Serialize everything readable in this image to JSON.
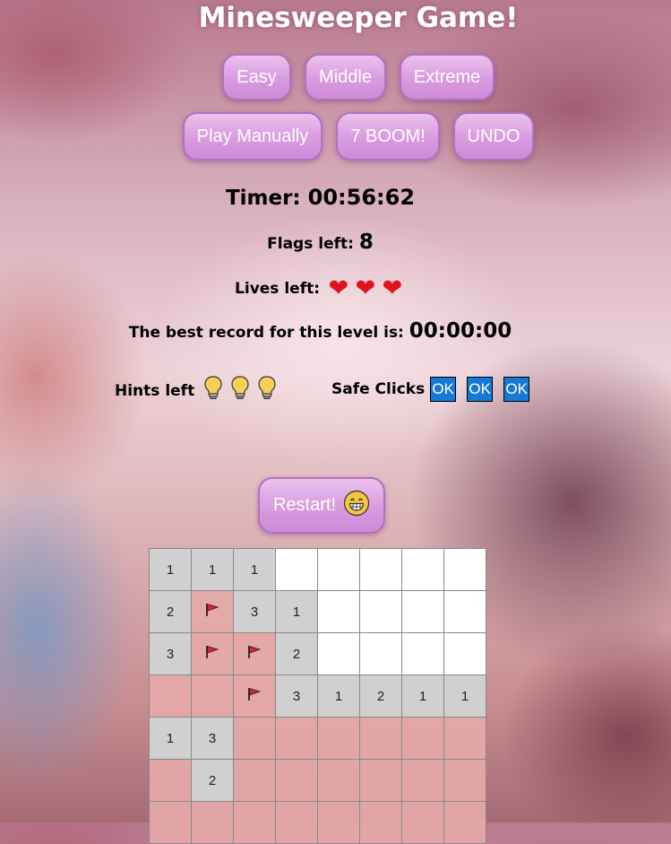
{
  "title": "Minesweeper Game!",
  "levels": [
    "Easy",
    "Middle",
    "Extreme"
  ],
  "actions": [
    "Play Manually",
    "7 BOOM!",
    "UNDO"
  ],
  "timer": {
    "label": "Timer:",
    "value": "00:56:62"
  },
  "flags": {
    "label": "Flags left:",
    "value": "8"
  },
  "lives": {
    "label": "Lives left:",
    "count": 3,
    "icon": "heart-icon",
    "color": "#e0141e"
  },
  "record": {
    "label": "The best record for this level is:",
    "value": "00:00:00"
  },
  "hints": {
    "label": "Hints left",
    "count": 3,
    "icon": "lightbulb-icon"
  },
  "safe_clicks": {
    "label": "Safe Clicks",
    "buttons": [
      "OK",
      "OK",
      "OK"
    ]
  },
  "restart": {
    "label": "Restart!",
    "icon": "grinning-face-icon"
  },
  "colors": {
    "hidden": "#e5a9a9",
    "open": "#d0d0d0",
    "empty": "#ffffff",
    "ok_button": "#1779d6",
    "button": "#d99be0"
  },
  "board": [
    [
      {
        "s": "open",
        "v": "1"
      },
      {
        "s": "open",
        "v": "1"
      },
      {
        "s": "open",
        "v": "1"
      },
      {
        "s": "empty",
        "v": ""
      },
      {
        "s": "empty",
        "v": ""
      },
      {
        "s": "empty",
        "v": ""
      },
      {
        "s": "empty",
        "v": ""
      },
      {
        "s": "empty",
        "v": ""
      }
    ],
    [
      {
        "s": "open",
        "v": "2"
      },
      {
        "s": "flag",
        "v": ""
      },
      {
        "s": "open",
        "v": "3"
      },
      {
        "s": "open",
        "v": "1"
      },
      {
        "s": "empty",
        "v": ""
      },
      {
        "s": "empty",
        "v": ""
      },
      {
        "s": "empty",
        "v": ""
      },
      {
        "s": "empty",
        "v": ""
      }
    ],
    [
      {
        "s": "open",
        "v": "3"
      },
      {
        "s": "flag",
        "v": ""
      },
      {
        "s": "flag",
        "v": ""
      },
      {
        "s": "open",
        "v": "2"
      },
      {
        "s": "empty",
        "v": ""
      },
      {
        "s": "empty",
        "v": ""
      },
      {
        "s": "empty",
        "v": ""
      },
      {
        "s": "empty",
        "v": ""
      }
    ],
    [
      {
        "s": "hidden",
        "v": ""
      },
      {
        "s": "hidden",
        "v": ""
      },
      {
        "s": "flag",
        "v": ""
      },
      {
        "s": "open",
        "v": "3"
      },
      {
        "s": "open",
        "v": "1"
      },
      {
        "s": "open",
        "v": "2"
      },
      {
        "s": "open",
        "v": "1"
      },
      {
        "s": "open",
        "v": "1"
      }
    ],
    [
      {
        "s": "open",
        "v": "1"
      },
      {
        "s": "open",
        "v": "3"
      },
      {
        "s": "hidden",
        "v": ""
      },
      {
        "s": "hidden",
        "v": ""
      },
      {
        "s": "hidden",
        "v": ""
      },
      {
        "s": "hidden",
        "v": ""
      },
      {
        "s": "hidden",
        "v": ""
      },
      {
        "s": "hidden",
        "v": ""
      }
    ],
    [
      {
        "s": "hidden",
        "v": ""
      },
      {
        "s": "open",
        "v": "2"
      },
      {
        "s": "hidden",
        "v": ""
      },
      {
        "s": "hidden",
        "v": ""
      },
      {
        "s": "hidden",
        "v": ""
      },
      {
        "s": "hidden",
        "v": ""
      },
      {
        "s": "hidden",
        "v": ""
      },
      {
        "s": "hidden",
        "v": ""
      }
    ],
    [
      {
        "s": "hidden",
        "v": ""
      },
      {
        "s": "hidden",
        "v": ""
      },
      {
        "s": "hidden",
        "v": ""
      },
      {
        "s": "hidden",
        "v": ""
      },
      {
        "s": "hidden",
        "v": ""
      },
      {
        "s": "hidden",
        "v": ""
      },
      {
        "s": "hidden",
        "v": ""
      },
      {
        "s": "hidden",
        "v": ""
      }
    ]
  ]
}
